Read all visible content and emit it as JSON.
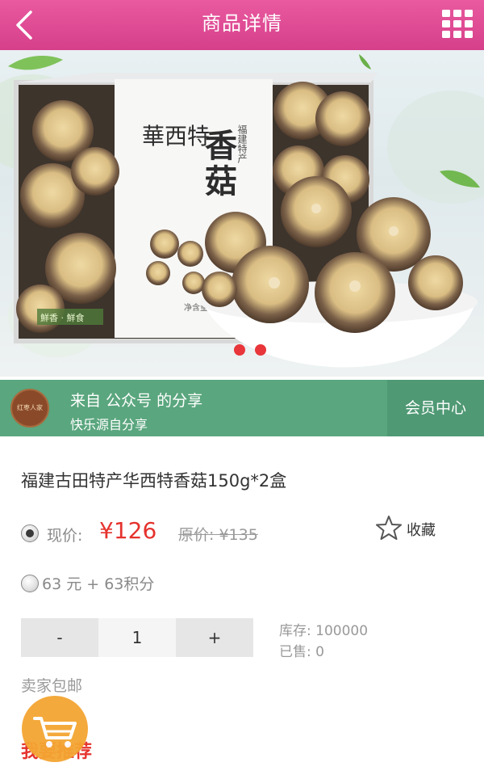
{
  "header": {
    "title": "商品详情",
    "back_icon": "chevron-left-icon",
    "menu_icon": "grid-menu-icon"
  },
  "hero": {
    "slide_count": 2,
    "box_brand": "華西特",
    "box_product": "香菇",
    "box_side_text": "福建特产",
    "box_bottom_text": "鮮香 · 鮮食",
    "box_net_weight": "净含量: 15"
  },
  "share": {
    "avatar_text": "红枣人家",
    "from_text": "来自 公众号 的分享",
    "slogan": "快乐源自分享",
    "member_center": "会员中心"
  },
  "product": {
    "name": "福建古田特产华西特香菇150g*2盒",
    "current_price_label": "现价:",
    "current_price": "¥126",
    "original_price_label": "原价:",
    "original_price": "¥135",
    "favorite_label": "收藏",
    "points_option": "63 元 + 63积分",
    "quantity_minus": "-",
    "quantity": "1",
    "quantity_plus": "+",
    "stock_label": "库存:",
    "stock": "100000",
    "sold_label": "已售:",
    "sold": "0",
    "shipping": "卖家包邮",
    "recommend": "我要推荐"
  },
  "colors": {
    "header": "#d63f8a",
    "share_bar": "#5aa67e",
    "price": "#e5322d",
    "cart_button": "#f4a532"
  }
}
